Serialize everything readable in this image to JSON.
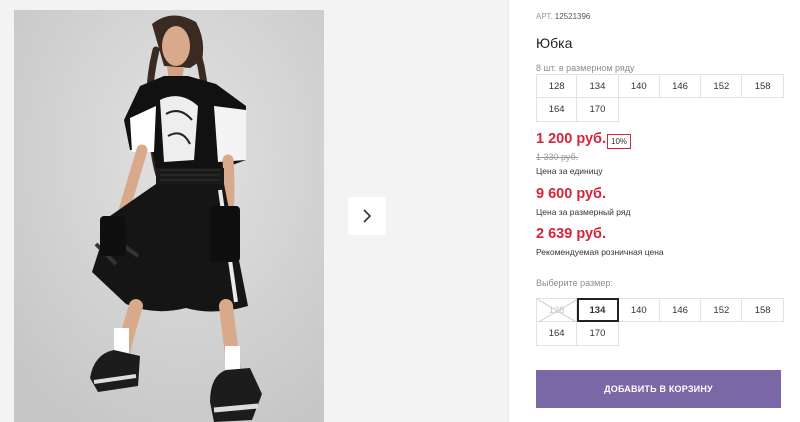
{
  "product": {
    "sku_label": "АРТ.",
    "sku": "12521396",
    "title": "Юбка"
  },
  "pack": {
    "note": "8 шт. в размерном ряду",
    "sizes": [
      "128",
      "134",
      "140",
      "146",
      "152",
      "158",
      "164",
      "170"
    ]
  },
  "pricing": {
    "unit_price": "1 200 руб.",
    "discount": "10%",
    "old_price": "1 330 руб.",
    "unit_caption": "Цена за единицу",
    "pack_price": "9 600 руб.",
    "pack_caption": "Цена за размерный ряд",
    "retail_price": "2 639 руб.",
    "retail_caption": "Рекомендуемая розничная цена",
    "accent_color": "#d8243a"
  },
  "size_picker": {
    "label": "Выберите размер:",
    "sizes": [
      "128",
      "134",
      "140",
      "146",
      "152",
      "158",
      "164",
      "170"
    ],
    "unavailable": [
      "128"
    ],
    "selected": "134"
  },
  "cart": {
    "button_label": "ДОБАВИТЬ В КОРЗИНУ",
    "button_color": "#7a68a6"
  },
  "gallery": {
    "next_icon": "chevron-right-icon"
  }
}
